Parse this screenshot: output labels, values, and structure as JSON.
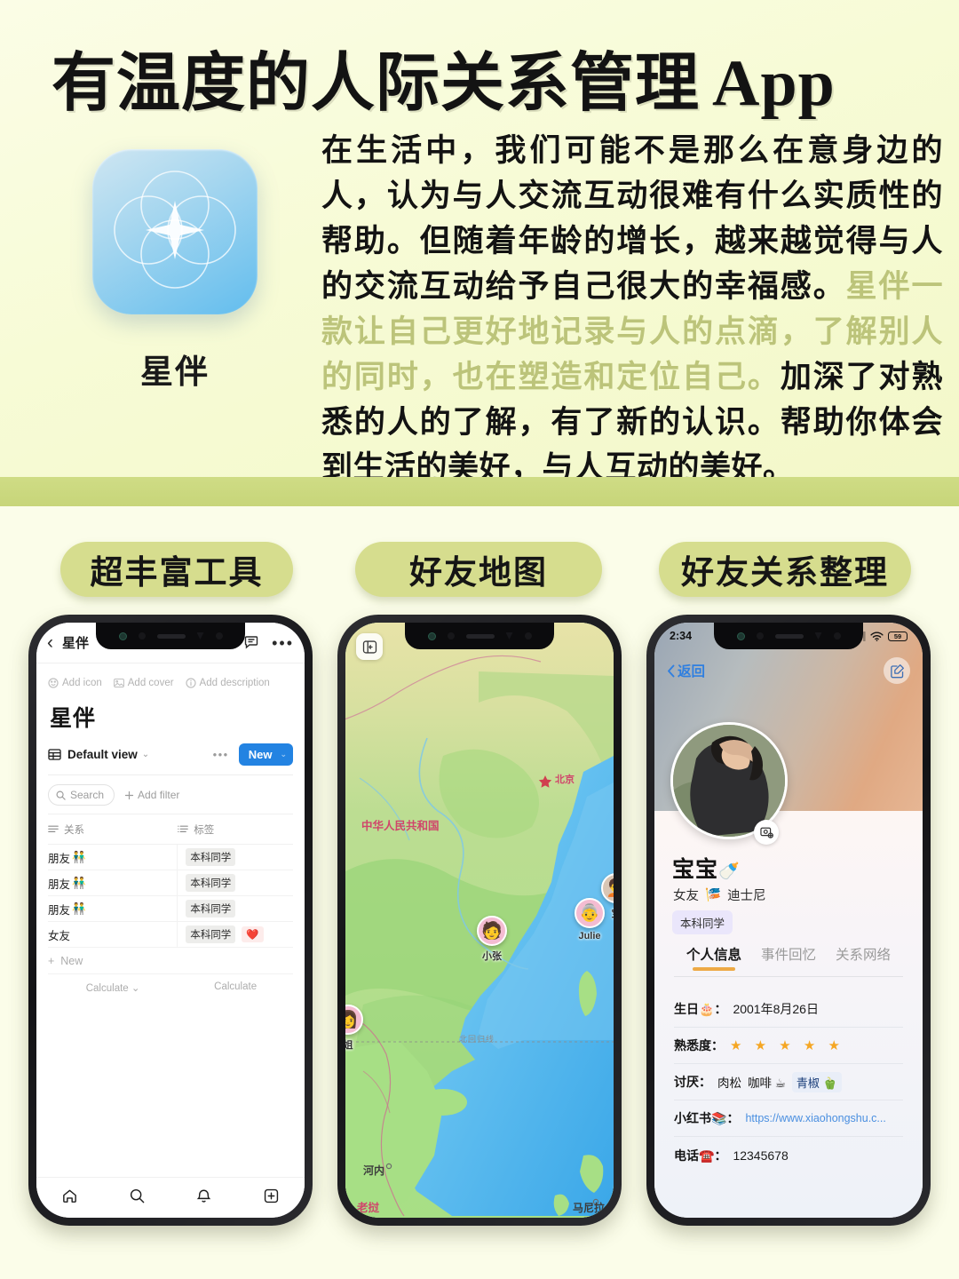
{
  "hero": {
    "title_cn": "有温度的人际关系管理",
    "title_en": "App",
    "app_name": "星伴",
    "paragraph_part1": "在生活中，我们可能不是那么在意身边的人，认为与人交流互动很难有什么实质性的帮助。但随着年龄的增长，越来越觉得与人的交流互动给予自己很大的幸福感。",
    "paragraph_highlight": "星伴一款让自己更好地记录与人的点滴，了解别人的同时，也在塑造和定位自己。",
    "paragraph_part2": "加深了对熟悉的人的了解，有了新的认识。帮助你体会到生活的美好，与人互动的美好。",
    "highlight_color": "#bcc47a",
    "background_color": "#f8fbdc",
    "divider_color": "#cfdc85"
  },
  "sections": [
    {
      "label": "超丰富工具"
    },
    {
      "label": "好友地图"
    },
    {
      "label": "好友关系整理"
    }
  ],
  "phone1": {
    "topbar": {
      "back_icon": "chevron-left-icon",
      "title": "星伴",
      "share_icon": "share-icon",
      "comment_icon": "comment-icon",
      "more_icon": "more-dots-icon"
    },
    "quick_actions": [
      {
        "icon": "emoji-icon",
        "label": "Add icon"
      },
      {
        "icon": "image-icon",
        "label": "Add cover"
      },
      {
        "icon": "info-icon",
        "label": "Add description"
      }
    ],
    "page_title": "星伴",
    "view": {
      "icon": "table-icon",
      "name": "Default view",
      "caret": "⌄",
      "more": "•••",
      "new_button": "New",
      "new_caret": "⌄",
      "accent_color": "#2383e2"
    },
    "filter_bar": {
      "search_label": "Search",
      "search_icon": "search-icon",
      "add_filter_label": "Add filter",
      "add_filter_icon": "plus-icon"
    },
    "columns": [
      {
        "icon": "text-lines-icon",
        "label": "关系"
      },
      {
        "icon": "multiselect-icon",
        "label": "标签"
      }
    ],
    "rows": [
      {
        "relation": "朋友",
        "relation_emoji": "👬",
        "tags": [
          "本科同学"
        ],
        "extra_tag": ""
      },
      {
        "relation": "朋友",
        "relation_emoji": "👬",
        "tags": [
          "本科同学"
        ],
        "extra_tag": ""
      },
      {
        "relation": "朋友",
        "relation_emoji": "👬",
        "tags": [
          "本科同学"
        ],
        "extra_tag": ""
      },
      {
        "relation": "女友",
        "relation_emoji": "",
        "tags": [
          "本科同学"
        ],
        "extra_tag": "❤️"
      }
    ],
    "new_row_label": "New",
    "calculate_left": "Calculate",
    "calculate_right": "Calculate",
    "tabbar": [
      {
        "icon": "home-icon"
      },
      {
        "icon": "search-icon"
      },
      {
        "icon": "bell-icon"
      },
      {
        "icon": "plus-box-icon"
      }
    ]
  },
  "phone2": {
    "layers_button_icon": "layers-icon",
    "labels": [
      {
        "text": "北京",
        "style": "star-red"
      },
      {
        "text": "中华人民共和国",
        "style": "country-red"
      },
      {
        "text": "北回归线",
        "style": "dim"
      },
      {
        "text": "河内",
        "style": "dark"
      },
      {
        "text": "老挝",
        "style": "country-red"
      },
      {
        "text": "马尼拉",
        "style": "dark"
      }
    ],
    "pins": [
      {
        "name": "小张",
        "emoji": "🧑"
      },
      {
        "name": "Julie",
        "emoji": "👵"
      },
      {
        "name": "宝",
        "emoji": "🧑‍🦱"
      },
      {
        "name": "姐",
        "emoji": "👩"
      }
    ]
  },
  "phone3": {
    "status_bar": {
      "time": "2:34",
      "signal_icon": "cellular-icon",
      "wifi_icon": "wifi-icon",
      "battery": "59"
    },
    "nav": {
      "back_label": "返回",
      "back_icon": "chevron-left-icon",
      "edit_icon": "edit-square-icon"
    },
    "avatar_camera_icon": "camera-icon",
    "name": "宝宝",
    "name_emoji": "🍼",
    "subtitle": "女友",
    "subtitle_emoji": "🎏",
    "subtitle_extra": "迪士尼",
    "badge": "本科同学",
    "tabs": [
      {
        "label": "个人信息",
        "active": true
      },
      {
        "label": "事件回忆",
        "active": false
      },
      {
        "label": "关系网络",
        "active": false
      }
    ],
    "tab_accent": "#eda945",
    "info": [
      {
        "key": "生日",
        "key_emoji": "🎂",
        "sep": "：",
        "value": "2001年8月26日",
        "type": "text"
      },
      {
        "key": "熟悉度",
        "key_emoji": "",
        "sep": "：",
        "value": "★ ★ ★ ★ ★",
        "type": "stars",
        "stars": 5
      },
      {
        "key": "讨厌",
        "key_emoji": "",
        "sep": "：",
        "value": "",
        "type": "chips",
        "chips": [
          "肉松",
          "咖啡 ☕",
          "青椒 🫑"
        ]
      },
      {
        "key": "小红书",
        "key_emoji": "📚",
        "sep": "：",
        "value": "https://www.xiaohongshu.c...",
        "type": "link"
      },
      {
        "key": "电话",
        "key_emoji": "☎️",
        "sep": "：",
        "value": "12345678",
        "type": "text"
      }
    ]
  }
}
